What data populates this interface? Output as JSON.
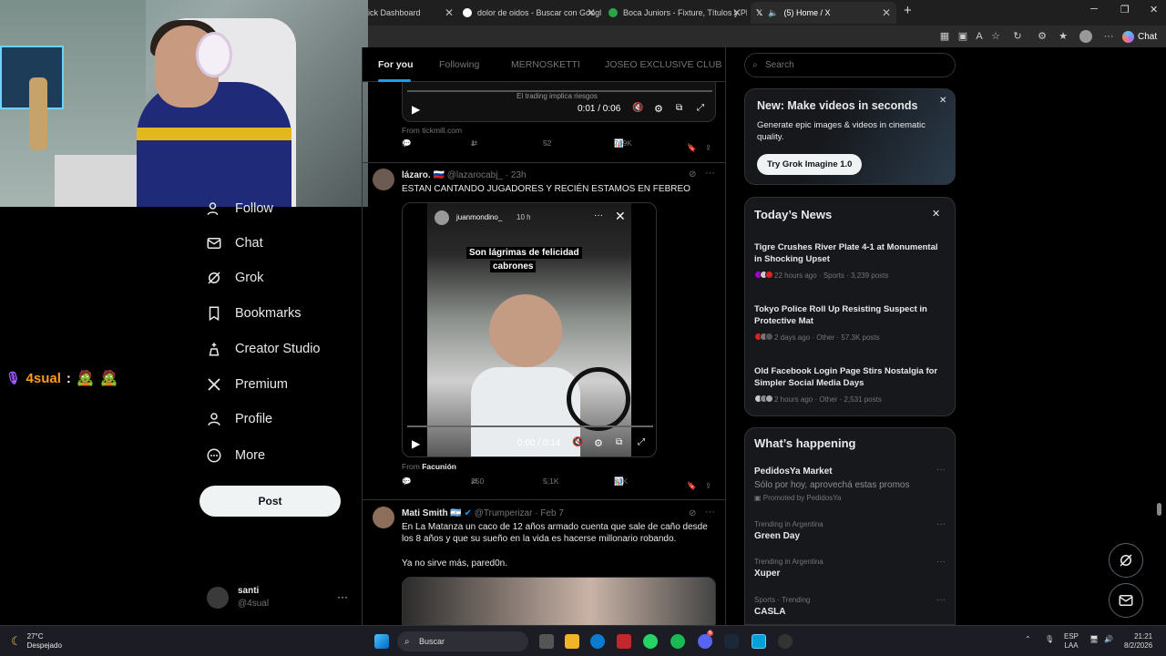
{
  "browser": {
    "tabs": [
      {
        "label": "ick Dashboard",
        "color": "#4a8df6"
      },
      {
        "label": "dolor de oidos - Buscar con Googl",
        "color": "#ffffff"
      },
      {
        "label": "Boca Juniors - Fixture, Títulos y Pla",
        "color": "#2aa54a"
      },
      {
        "label": "(5) Home / X",
        "color": "#ffffff"
      }
    ],
    "chat_label": "Chat"
  },
  "overlay": {
    "user": "4sual",
    "sep": ":"
  },
  "nav": {
    "items": [
      {
        "label": "Follow"
      },
      {
        "label": "Chat"
      },
      {
        "label": "Grok"
      },
      {
        "label": "Bookmarks"
      },
      {
        "label": "Creator Studio"
      },
      {
        "label": "Premium"
      },
      {
        "label": "Profile"
      },
      {
        "label": "More"
      }
    ],
    "post_label": "Post",
    "account": {
      "name": "santi",
      "handle": "@4sual",
      "more": "···"
    }
  },
  "timeline": {
    "tabs": [
      "For you",
      "Following",
      "MERNOSKETTI",
      "JOSEO EXCLUSIVE CLUB"
    ],
    "tweet1": {
      "video_time": "0:01 / 0:06",
      "caption": "El trading implica riesgos",
      "from": "From tickmill.com",
      "replies": "1",
      "reposts": "1",
      "likes": "52",
      "views": "769K"
    },
    "tweet2": {
      "name": "lázaro.",
      "handle": "@lazarocabj_",
      "time": "· 23h",
      "text": "ESTAN CANTANDO JUGADORES Y RECIÉN ESTAMOS EN FEBREO",
      "story_user": "juanmondino_",
      "story_time": "10 h",
      "story_caption_1": "Son lágrimas de felicidad",
      "story_caption_2": "cabrones",
      "video_time": "0:00 / 0:14",
      "from_prefix": "From",
      "from_source": "Facunión",
      "replies": "6",
      "reposts": "250",
      "likes": "5,1K",
      "views": "80K"
    },
    "tweet3": {
      "name": "Mati Smith",
      "handle": "@Trumperizar",
      "time": "· Feb 7",
      "text1": "En La Matanza un caco de 12 años armado cuenta que sale de caño desde los 8 años y que su sueño en la vida es hacerse millonario robando.",
      "text2": "Ya no sirve más, pared0n."
    }
  },
  "sidebar": {
    "search_placeholder": "Search",
    "grok": {
      "title": "New: Make videos in seconds",
      "body": "Generate epic images & videos in cinematic quality.",
      "button": "Try Grok Imagine 1.0"
    },
    "news": {
      "title": "Today’s News",
      "items": [
        {
          "title": "Tigre Crushes River Plate 4-1 at Monumental in Shocking Upset",
          "meta": "22 hours ago · Sports · 3,239 posts"
        },
        {
          "title": "Tokyo Police Roll Up Resisting Suspect in Protective Mat",
          "meta": "2 days ago · Other · 57.3K posts"
        },
        {
          "title": "Old Facebook Login Page Stirs Nostalgia for Simpler Social Media Days",
          "meta": "2 hours ago · Other · 2,531 posts"
        }
      ]
    },
    "happening": {
      "title": "What’s happening",
      "promo_name": "PedidosYa Market",
      "promo_text": "Sólo por hoy, aprovechá estas promos",
      "promo_by": "Promoted by PedidosYa",
      "trends": [
        {
          "context": "Trending in Argentina",
          "name": "Green Day"
        },
        {
          "context": "Trending in Argentina",
          "name": "Xuper"
        },
        {
          "context": "Sports · Trending",
          "name": "CASLA"
        }
      ]
    }
  },
  "taskbar": {
    "temp": "27°C",
    "condition": "Despejado",
    "search": "Buscar",
    "lang1": "ESP",
    "lang2": "LAA",
    "time": "21:21",
    "date": "8/2/2026",
    "discord_badge": "6"
  }
}
